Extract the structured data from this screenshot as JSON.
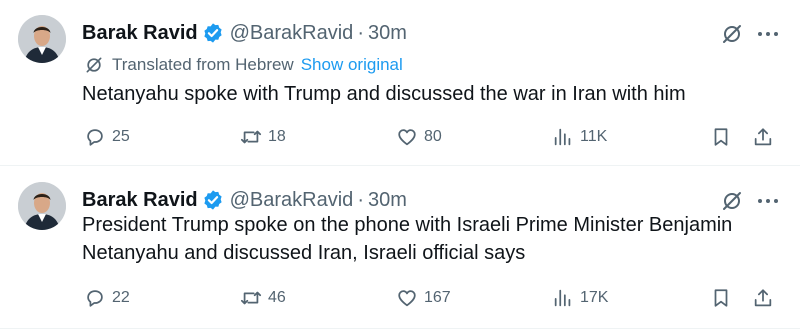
{
  "colors": {
    "text_primary": "#0f1419",
    "text_secondary": "#536471",
    "link": "#1d9bf0",
    "verified": "#1d9bf0",
    "divider": "#eff3f4"
  },
  "tweets": [
    {
      "author": {
        "name": "Barak Ravid",
        "handle": "@BarakRavid",
        "verified": true
      },
      "separator": "·",
      "time": "30m",
      "translation": {
        "label": "Translated from Hebrew",
        "link": "Show original"
      },
      "text": "Netanyahu spoke with Trump and discussed the war in Iran with him",
      "stats": {
        "replies": "25",
        "reposts": "18",
        "likes": "80",
        "views": "11K"
      },
      "icons": [
        "grok-icon",
        "more-icon",
        "reply-icon",
        "repost-icon",
        "like-icon",
        "views-icon",
        "bookmark-icon",
        "share-icon"
      ]
    },
    {
      "author": {
        "name": "Barak Ravid",
        "handle": "@BarakRavid",
        "verified": true
      },
      "separator": "·",
      "time": "30m",
      "text": "President Trump spoke on the phone with Israeli Prime Minister Benjamin Netanyahu and discussed Iran, Israeli official says",
      "stats": {
        "replies": "22",
        "reposts": "46",
        "likes": "167",
        "views": "17K"
      },
      "icons": [
        "grok-icon",
        "more-icon",
        "reply-icon",
        "repost-icon",
        "like-icon",
        "views-icon",
        "bookmark-icon",
        "share-icon"
      ]
    }
  ]
}
